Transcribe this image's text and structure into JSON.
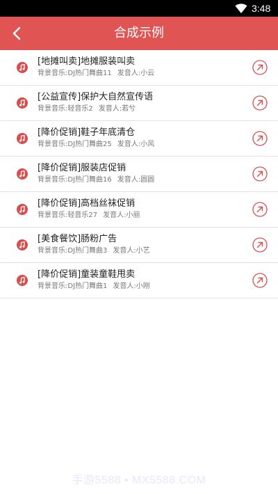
{
  "status_bar": {
    "time": "3:48",
    "icons": [
      "wifi-icon"
    ]
  },
  "app_bar": {
    "title": "合成示例",
    "back_icon": "chevron-left-icon"
  },
  "colors": {
    "accent": "#e05454",
    "icon_red": "#d94d4d"
  },
  "items": [
    {
      "title": "[地摊叫卖]地摊服装叫卖",
      "music": "背景音乐:DJ热门舞曲11",
      "speaker": "发音人:小云"
    },
    {
      "title": "[公益宣传]保护大自然宣传语",
      "music": "背景音乐:轻音乐2",
      "speaker": "发音人:若兮"
    },
    {
      "title": "[降价促销]鞋子年底清仓",
      "music": "背景音乐:DJ热门舞曲25",
      "speaker": "发音人:小风"
    },
    {
      "title": "[降价促销]服装店促销",
      "music": "背景音乐:DJ热门舞曲16",
      "speaker": "发音人:圆圆"
    },
    {
      "title": "[降价促销]高档丝袜促销",
      "music": "背景音乐:轻音乐27",
      "speaker": "发音人:小丽"
    },
    {
      "title": "[美食餐饮]肠粉广告",
      "music": "背景音乐:DJ热门舞曲3",
      "speaker": "发音人:小艺"
    },
    {
      "title": "[降价促销]童装童鞋甩卖",
      "music": "背景音乐:DJ热门舞曲1",
      "speaker": "发音人:小刚"
    }
  ],
  "watermark": "手游5588 • MX5588.COM"
}
